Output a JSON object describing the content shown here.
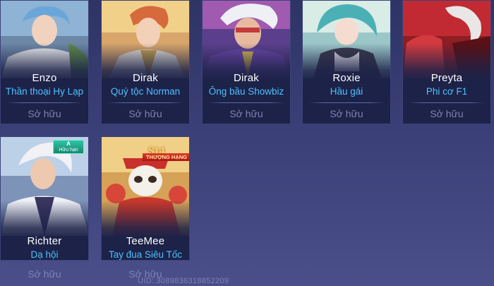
{
  "cards": [
    {
      "hero": "Enzo",
      "skin": "Thần thoại Hy Lạp",
      "status": "Sở hữu"
    },
    {
      "hero": "Dirak",
      "skin": "Quý tộc Norman",
      "status": "Sở hữu"
    },
    {
      "hero": "Dirak",
      "skin": "Ông bầu Showbiz",
      "status": "Sở hữu"
    },
    {
      "hero": "Roxie",
      "skin": "Hầu gái",
      "status": "Sở hữu"
    },
    {
      "hero": "Preyta",
      "skin": "Phi cơ F1",
      "status": "Sở hữu"
    },
    {
      "hero": "Richter",
      "skin": "Dạ hội",
      "status": "Sở hữu",
      "badge_top": "A",
      "badge_bottom": "Hữu hạn"
    },
    {
      "hero": "TeeMee",
      "skin": "Tay đua Siêu Tốc",
      "status": "Sở hữu",
      "badge_top": "S14",
      "badge_bottom": "THƯỢNG HẠNG"
    }
  ],
  "uid_text": "UID: 3089836318852209",
  "colors": {
    "skin_name": "#4fc1ff",
    "card_bg": "#1c2248",
    "owned": "#7c84b4"
  }
}
